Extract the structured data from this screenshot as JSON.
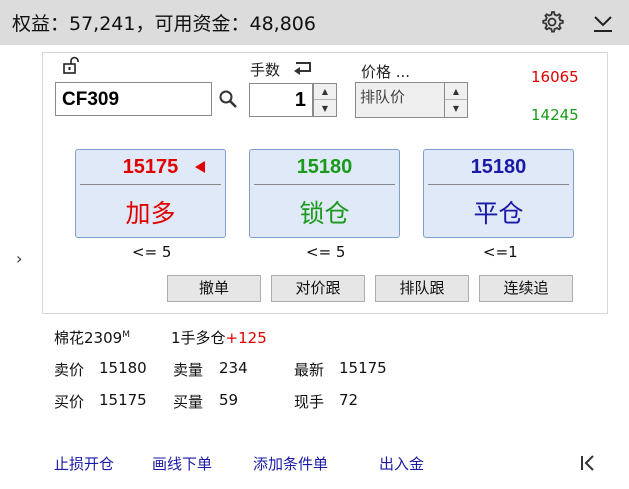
{
  "header": {
    "equity_line": "权益：57,241，可用资金：48,806",
    "settings_icon": "gear-icon",
    "collapse_icon": "chevron-down-bar-icon"
  },
  "order_panel": {
    "lock_icon": "unlock-icon",
    "symbol": "CF309",
    "search_icon": "search-icon",
    "quantity_label": "手数",
    "quantity_toggle_icon": "return-arrow-icon",
    "quantity_value": "1",
    "price_label": "价格 ...",
    "price_mode": "排队价",
    "price_high": "16065",
    "price_low": "14245",
    "buttons": [
      {
        "price": "15175",
        "action": "加多",
        "limit": "<= 5"
      },
      {
        "price": "15180",
        "action": "锁仓",
        "limit": "<= 5"
      },
      {
        "price": "15180",
        "action": "平仓",
        "limit": "<=1"
      }
    ],
    "actions": [
      "撤单",
      "对价跟",
      "排队跟",
      "连续追"
    ]
  },
  "quote": {
    "name": "棉花2309",
    "name_mark": "M",
    "position": "1手多仓",
    "pnl": "+125",
    "ask_label": "卖价",
    "ask_price": "15180",
    "ask_vol_label": "卖量",
    "ask_vol": "234",
    "last_label": "最新",
    "last_price": "15175",
    "bid_label": "买价",
    "bid_price": "15175",
    "bid_vol_label": "买量",
    "bid_vol": "59",
    "hand_label": "现手",
    "hand": "72"
  },
  "footer": {
    "links": [
      "止损开仓",
      "画线下单",
      "添加条件单",
      "出入金"
    ],
    "first_icon": "skip-to-start-icon"
  },
  "colors": {
    "red": "#e00000",
    "green": "#1a9a1a",
    "blue": "#1a1aa6"
  }
}
